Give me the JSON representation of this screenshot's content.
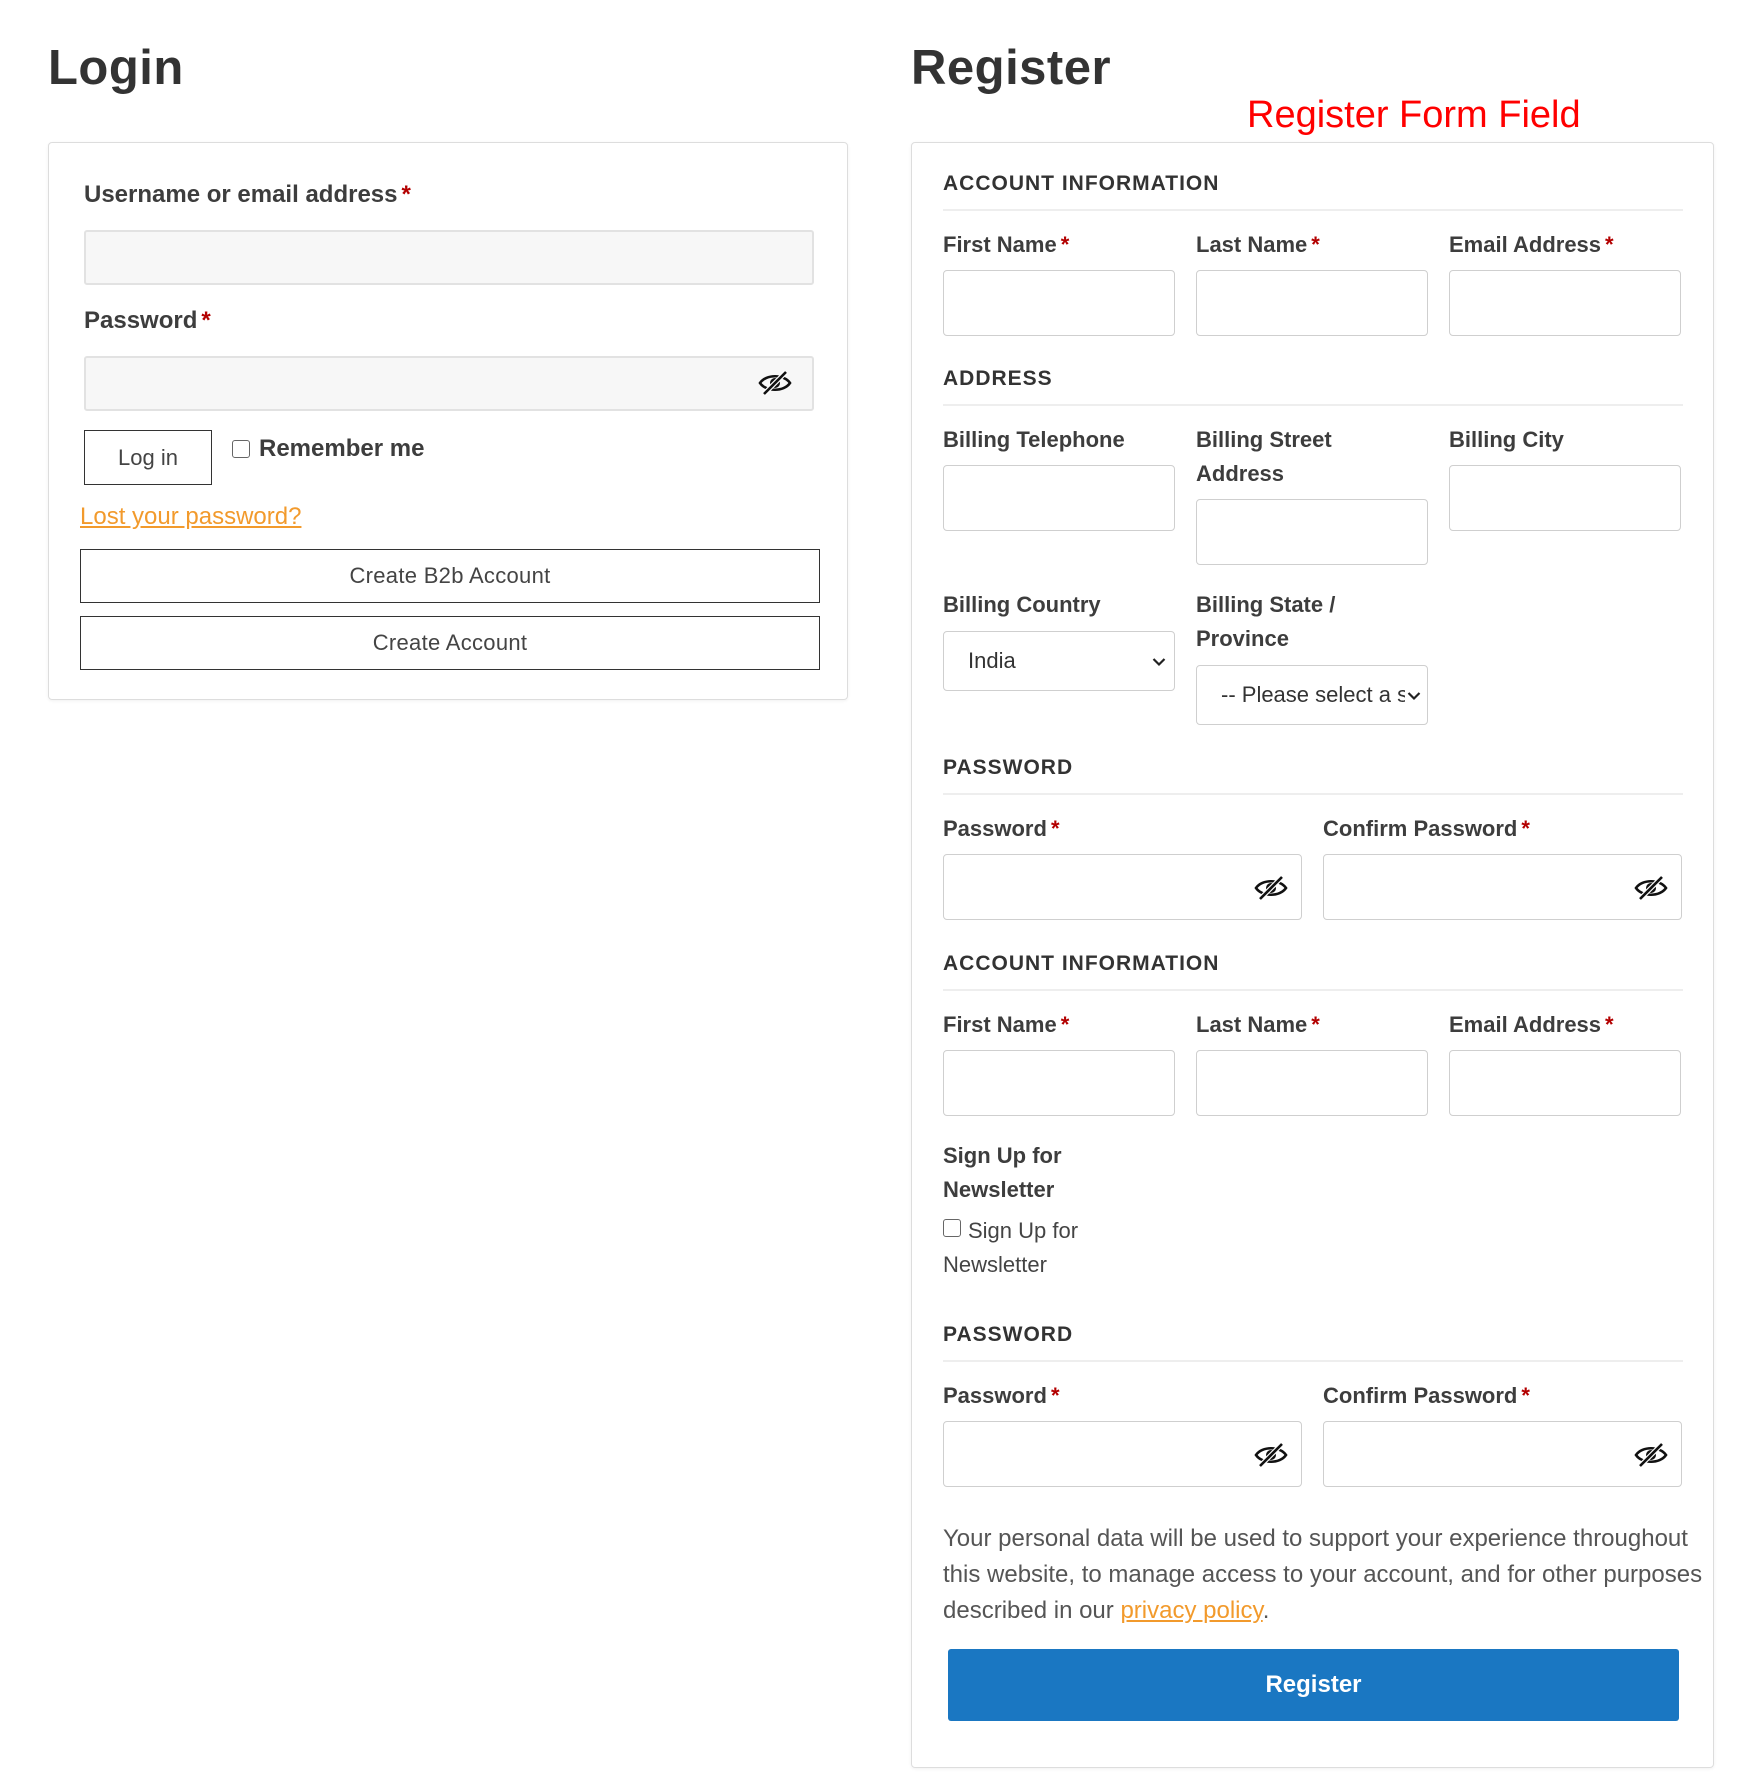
{
  "login": {
    "title": "Login",
    "username_label": "Username or email address",
    "password_label": "Password",
    "required_mark": "*",
    "login_button": "Log in",
    "remember_me": "Remember me",
    "lost_password": "Lost your password?",
    "create_b2b": "Create B2b Account",
    "create_account": "Create Account"
  },
  "register": {
    "title": "Register",
    "annotation": "Register Form Field",
    "required_mark": "*",
    "sec1": {
      "heading": "ACCOUNT INFORMATION",
      "first_name": "First Name",
      "last_name": "Last Name",
      "email": "Email Address"
    },
    "address": {
      "heading": "ADDRESS",
      "telephone": "Billing Telephone",
      "street": "Billing Street Address",
      "city": "Billing City",
      "country": "Billing Country",
      "country_value": "India",
      "state": "Billing State / Province",
      "state_value": "-- Please select a state --"
    },
    "pw1": {
      "heading": "PASSWORD",
      "password": "Password",
      "confirm": "Confirm Password"
    },
    "sec2": {
      "heading": "ACCOUNT INFORMATION",
      "first_name": "First Name",
      "last_name": "Last Name",
      "email": "Email Address"
    },
    "newsletter": {
      "label": "Sign Up for Newsletter",
      "checkbox_label": "Sign Up for Newsletter"
    },
    "pw2": {
      "heading": "PASSWORD",
      "password": "Password",
      "confirm": "Confirm Password"
    },
    "privacy_text": "Your personal data will be used to support your experience throughout this website, to manage access to your account, and for other purposes described in our ",
    "privacy_link": "privacy policy",
    "privacy_end": ".",
    "register_button": "Register"
  },
  "colors": {
    "accent": "#1a77c2",
    "link": "#f29a2c",
    "required": "#b30000",
    "annotation": "#ff0000"
  }
}
